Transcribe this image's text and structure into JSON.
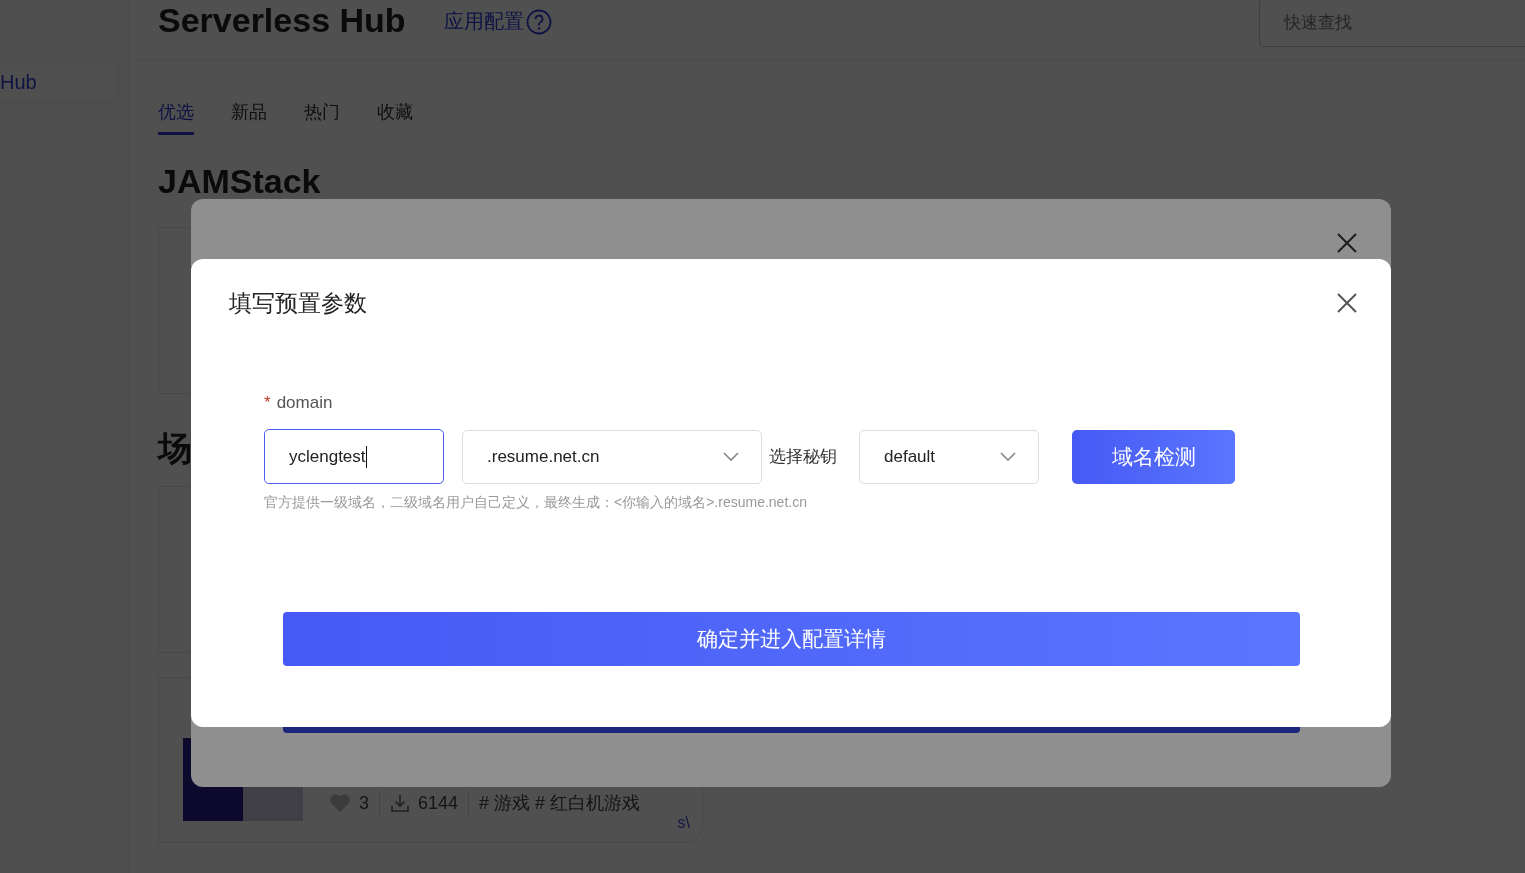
{
  "sidebar": {
    "items": [
      {
        "label": "Hub",
        "selected": true
      }
    ]
  },
  "header": {
    "title": "Serverless Hub",
    "config_link": "应用配置",
    "search": {
      "placeholder": "快速查找"
    }
  },
  "tabs": [
    {
      "label": "优选",
      "selected": true
    },
    {
      "label": "新品",
      "selected": false
    },
    {
      "label": "热门",
      "selected": false
    },
    {
      "label": "收藏",
      "selected": false
    }
  ],
  "sections": [
    {
      "title": "JAMStack"
    },
    {
      "title": "场"
    }
  ],
  "app_card": {
    "likes": "3",
    "downloads": "6144",
    "tags": "# 游戏 # 红白机游戏",
    "badge": "s\\"
  },
  "dialog": {
    "title": "填写预置参数",
    "field": {
      "required_mark": "*",
      "label": "domain",
      "value": "yclengtest"
    },
    "suffix_select": ".resume.net.cn",
    "key_label": "选择秘钥",
    "key_select": "default",
    "check_button": "域名检测",
    "hint": "官方提供一级域名，二级域名用户自己定义，最终生成：<你输入的域名>.resume.net.cn",
    "confirm_button": "确定并进入配置详情"
  }
}
